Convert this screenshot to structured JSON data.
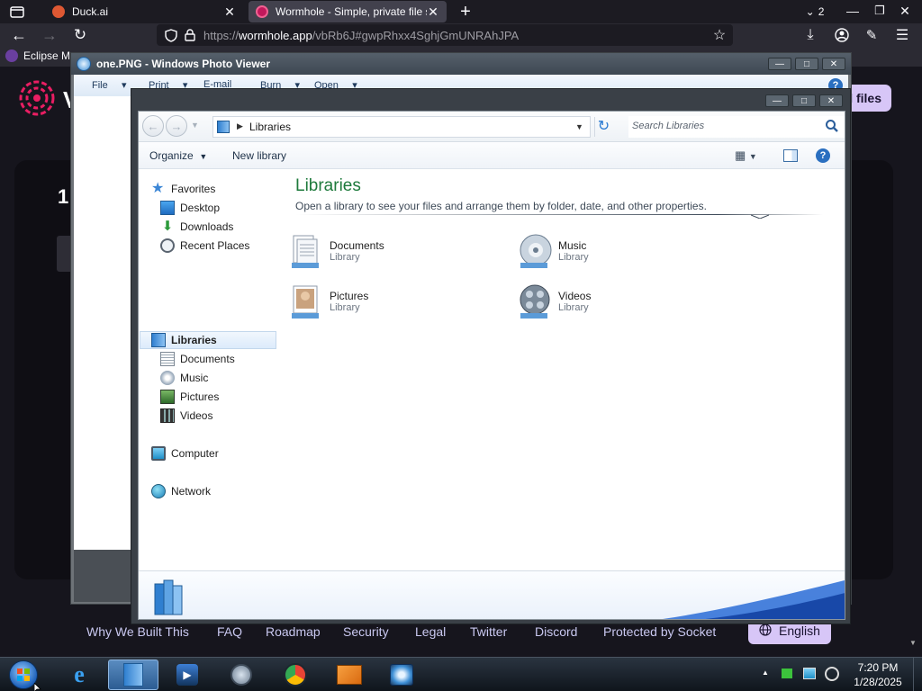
{
  "browser": {
    "tabs": [
      {
        "title": "Duck.ai",
        "close": "✕"
      },
      {
        "title": "Wormhole - Simple, private file s",
        "close": "✕"
      }
    ],
    "new_tab": "+",
    "tab_count": "2",
    "url": {
      "scheme": "https://",
      "host": "wormhole.app",
      "path": "/vbRb6J#gwpRhxx4SghjGmUNRAhJPA"
    },
    "bookmark": "Eclipse M..."
  },
  "site": {
    "header_button": "l files",
    "heading_partial": "V",
    "number_partial": "1",
    "footer_links": [
      "Why We Built This",
      "FAQ",
      "Roadmap",
      "Security",
      "Legal",
      "Twitter",
      "Discord",
      "Protected by Socket"
    ],
    "language": "English"
  },
  "photo_viewer": {
    "title": "one.PNG - Windows Photo Viewer",
    "menu": [
      "File",
      "Print",
      "E-mail",
      "Burn",
      "Open"
    ]
  },
  "explorer": {
    "breadcrumb": "Libraries",
    "search_placeholder": "Search Libraries",
    "toolbar": {
      "organize": "Organize",
      "new_library": "New library"
    },
    "nav": {
      "favorites": "Favorites",
      "favorites_items": [
        "Desktop",
        "Downloads",
        "Recent Places"
      ],
      "libraries": "Libraries",
      "libraries_items": [
        "Documents",
        "Music",
        "Pictures",
        "Videos"
      ],
      "computer": "Computer",
      "network": "Network"
    },
    "heading": "Libraries",
    "description": "Open a library to see your files and arrange them by folder, date, and other properties.",
    "libraries": [
      {
        "name": "Documents",
        "type": "Library",
        "icon": "documents-library-icon"
      },
      {
        "name": "Music",
        "type": "Library",
        "icon": "music-library-icon"
      },
      {
        "name": "Pictures",
        "type": "Library",
        "icon": "pictures-library-icon"
      },
      {
        "name": "Videos",
        "type": "Library",
        "icon": "videos-library-icon"
      }
    ]
  },
  "taskbar": {
    "time": "7:20 PM",
    "date": "1/28/2025"
  },
  "colors": {
    "browser_bg": "#1c1b22",
    "site_accent": "#d7c6f7",
    "library_heading": "#1e7a3c",
    "taskbar": "#1a222b"
  }
}
